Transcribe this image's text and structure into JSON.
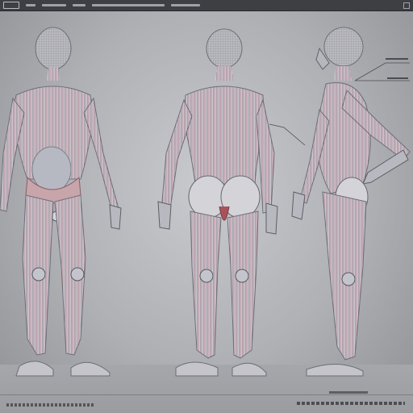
{
  "app": {
    "title": ""
  },
  "toolbar": {
    "items": [
      "",
      "",
      "",
      ""
    ]
  },
  "viewport": {
    "background": "#b8babd",
    "views": [
      {
        "name": "front-view"
      },
      {
        "name": "back-view"
      },
      {
        "name": "side-view"
      }
    ]
  },
  "colors": {
    "muscle_red": "#b0525b",
    "tendon_white": "#e7e5e9",
    "body_gray": "#9ea0a8",
    "joint_gray": "#c9cacf"
  }
}
